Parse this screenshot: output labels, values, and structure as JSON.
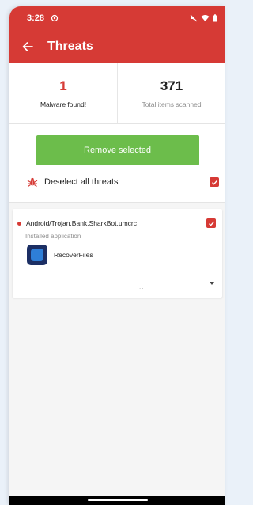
{
  "status_bar": {
    "time": "3:28"
  },
  "app_bar": {
    "title": "Threats"
  },
  "stats": {
    "malware_count": "1",
    "malware_label": "Malware found!",
    "total_count": "371",
    "total_label": "Total items scanned"
  },
  "actions": {
    "remove_label": "Remove selected",
    "deselect_label": "Deselect all threats",
    "deselect_checked": true
  },
  "threat": {
    "name": "Android/Trojan.Bank.SharkBot.umcrc",
    "type": "Installed application",
    "app_name": "RecoverFiles",
    "more": "...",
    "checked": true
  },
  "colors": {
    "accent": "#d63a35",
    "button": "#6cbd4b"
  }
}
